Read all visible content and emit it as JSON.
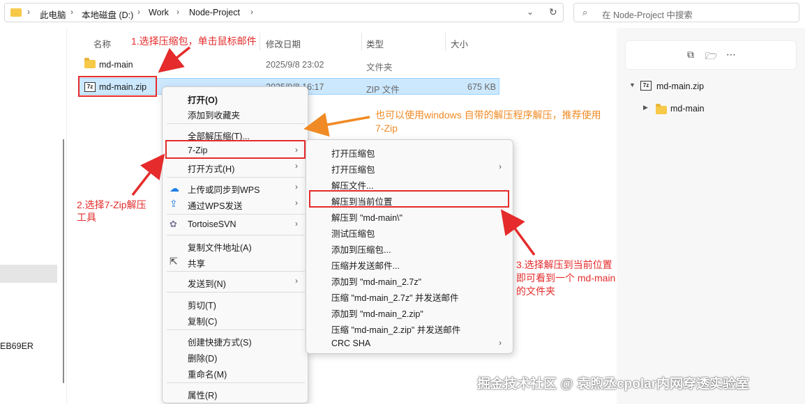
{
  "address": {
    "crumbs": [
      "此电脑",
      "本地磁盘 (D:)",
      "Work",
      "Node-Project"
    ],
    "search_placeholder": "在 Node-Project 中搜索"
  },
  "leftnav": {
    "partial_text": "EB69ER"
  },
  "columns": {
    "name": "名称",
    "modified": "修改日期",
    "type": "类型",
    "size": "大小"
  },
  "files": [
    {
      "name": "md-main",
      "modified": "2025/9/8 23:02",
      "type": "文件夹",
      "size": ""
    },
    {
      "name": "md-main.zip",
      "modified": "2025/9/8 16:17",
      "type": "ZIP 文件",
      "size": "675 KB"
    }
  ],
  "preview": {
    "tree": [
      {
        "label": "md-main.zip"
      },
      {
        "label": "md-main"
      }
    ]
  },
  "context_menu": {
    "open": "打开(O)",
    "add_fav": "添加到收藏夹",
    "extract_all": "全部解压缩(T)...",
    "sevenzip": "7-Zip",
    "open_with": "打开方式(H)",
    "wps_sync": "上传或同步到WPS",
    "wps_send": "通过WPS发送",
    "svn": "TortoiseSVN",
    "copy_path": "复制文件地址(A)",
    "share": "共享",
    "send_to": "发送到(N)",
    "cut": "剪切(T)",
    "copy": "复制(C)",
    "shortcut": "创建快捷方式(S)",
    "delete": "删除(D)",
    "rename": "重命名(M)",
    "properties": "属性(R)"
  },
  "submenu": {
    "items": [
      "打开压缩包",
      "打开压缩包",
      "解压文件...",
      "解压到当前位置",
      "解压到 \"md-main\\\"",
      "测试压缩包",
      "添加到压缩包...",
      "压缩并发送邮件...",
      "添加到 \"md-main_2.7z\"",
      "压缩 \"md-main_2.7z\" 并发送邮件",
      "添加到 \"md-main_2.zip\"",
      "压缩 \"md-main_2.zip\" 并发送邮件",
      "CRC SHA"
    ]
  },
  "annotations": {
    "step1": "1.选择压缩包，单击鼠标邮件",
    "step2_l1": "2.选择7-Zip解压",
    "step2_l2": "工具",
    "tip_l1": "也可以使用windows 自带的解压程序解压，推荐使用",
    "tip_l2": "7-Zip",
    "step3_l1": "3.选择解压到当前位置",
    "step3_l2": "即可看到一个 md-main",
    "step3_l3": "的文件夹"
  },
  "watermark": "掘金技术社区 @ 袁煦丞cpolar内网穿透实验室",
  "colors": {
    "annotation_red": "#e52b2b",
    "annotation_orange": "#f08a24",
    "selection": "#cce8ff"
  }
}
